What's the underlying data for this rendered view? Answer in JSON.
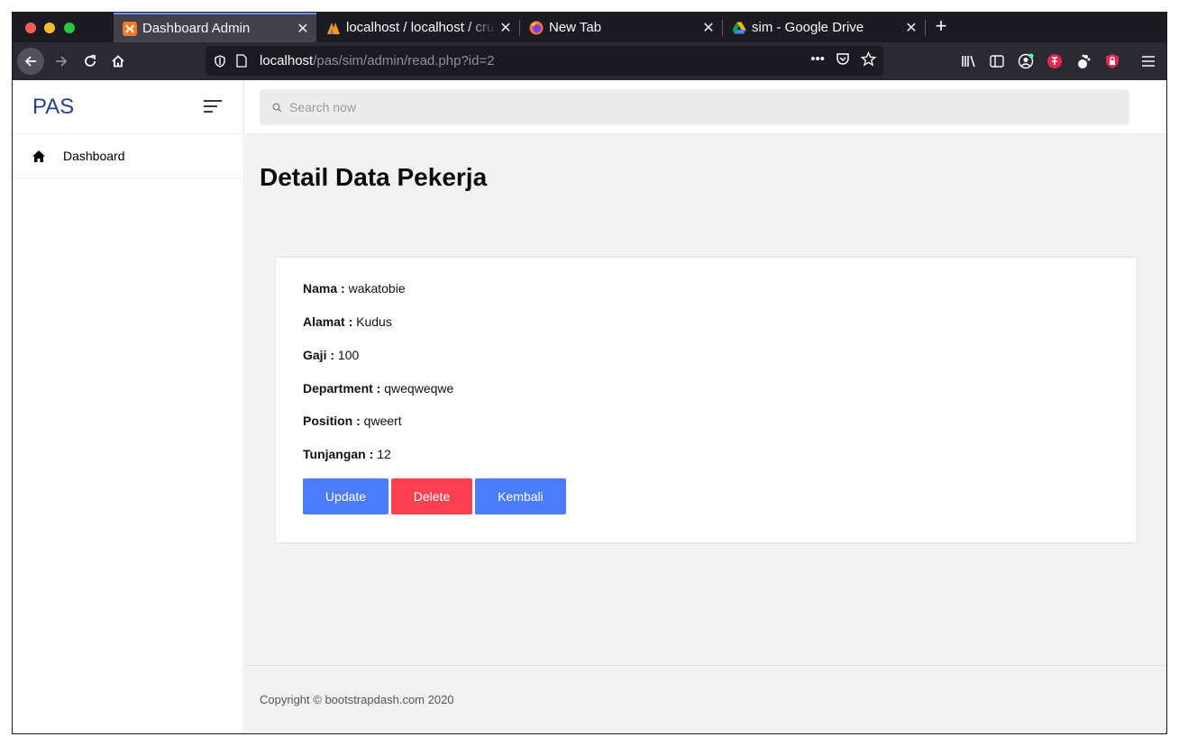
{
  "browser": {
    "tabs": [
      {
        "title": "Dashboard Admin",
        "active": true,
        "icon": "xampp-icon"
      },
      {
        "title": "localhost / localhost / crud",
        "active": false,
        "icon": "phpmyadmin-icon"
      },
      {
        "title": "New Tab",
        "active": false,
        "icon": "firefox-icon"
      },
      {
        "title": "sim - Google Drive",
        "active": false,
        "icon": "google-drive-icon"
      }
    ],
    "close_glyph": "✕",
    "new_tab_glyph": "+",
    "url": {
      "host": "localhost",
      "path": "/pas/sim/admin/read.php?id=2"
    },
    "url_more_glyph": "•••"
  },
  "sidebar": {
    "brand": "PAS",
    "items": [
      {
        "label": "Dashboard",
        "icon": "home-icon"
      }
    ]
  },
  "search": {
    "placeholder": "Search now"
  },
  "page": {
    "title": "Detail Data Pekerja"
  },
  "detail": {
    "fields": [
      {
        "label": "Nama :",
        "value": "wakatobie"
      },
      {
        "label": "Alamat :",
        "value": "Kudus"
      },
      {
        "label": "Gaji :",
        "value": "100"
      },
      {
        "label": "Department :",
        "value": "qweqweqwe"
      },
      {
        "label": "Position :",
        "value": "qweert"
      },
      {
        "label": "Tunjangan :",
        "value": "12"
      }
    ],
    "buttons": {
      "update": "Update",
      "delete": "Delete",
      "kembali": "Kembali"
    }
  },
  "colors": {
    "primary": "#4b7bff",
    "danger": "#ff4052",
    "brand": "#283d8f"
  },
  "footer": {
    "text": "Copyright © bootstrapdash.com 2020"
  }
}
